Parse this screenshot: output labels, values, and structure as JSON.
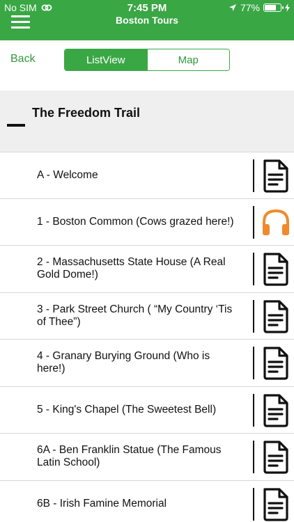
{
  "status_bar": {
    "carrier": "No SIM",
    "time": "7:45 PM",
    "battery_percent": "77%",
    "battery_level": 0.77
  },
  "header": {
    "title": "Boston Tours",
    "menu_icon": "hamburger-icon",
    "color": "#3aa745"
  },
  "nav": {
    "back_label": "Back",
    "segments": [
      {
        "label": "ListView",
        "active": true
      },
      {
        "label": "Map",
        "active": false
      }
    ]
  },
  "section": {
    "title": "The Freedom Trail",
    "collapse_icon": "minus-icon"
  },
  "stops": [
    {
      "label": "A - Welcome",
      "icon": "document-icon"
    },
    {
      "label": "1 - Boston Common (Cows grazed here!)",
      "icon": "headphones-icon"
    },
    {
      "label": "2 - Massachusetts State House (A Real Gold Dome!)",
      "icon": "document-icon"
    },
    {
      "label": "3 - Park Street Church ( “My Country ‘Tis of Thee”)",
      "icon": "document-icon"
    },
    {
      "label": "4 - Granary Burying Ground (Who is here!)",
      "icon": "document-icon"
    },
    {
      "label": "5 - King's Chapel (The Sweetest Bell)",
      "icon": "document-icon"
    },
    {
      "label": "6A - Ben Franklin Statue (The Famous Latin School)",
      "icon": "document-icon"
    },
    {
      "label": "6B - Irish Famine Memorial",
      "icon": "document-icon"
    }
  ],
  "colors": {
    "accent": "#3aa745",
    "headphones": "#f08a2e"
  }
}
